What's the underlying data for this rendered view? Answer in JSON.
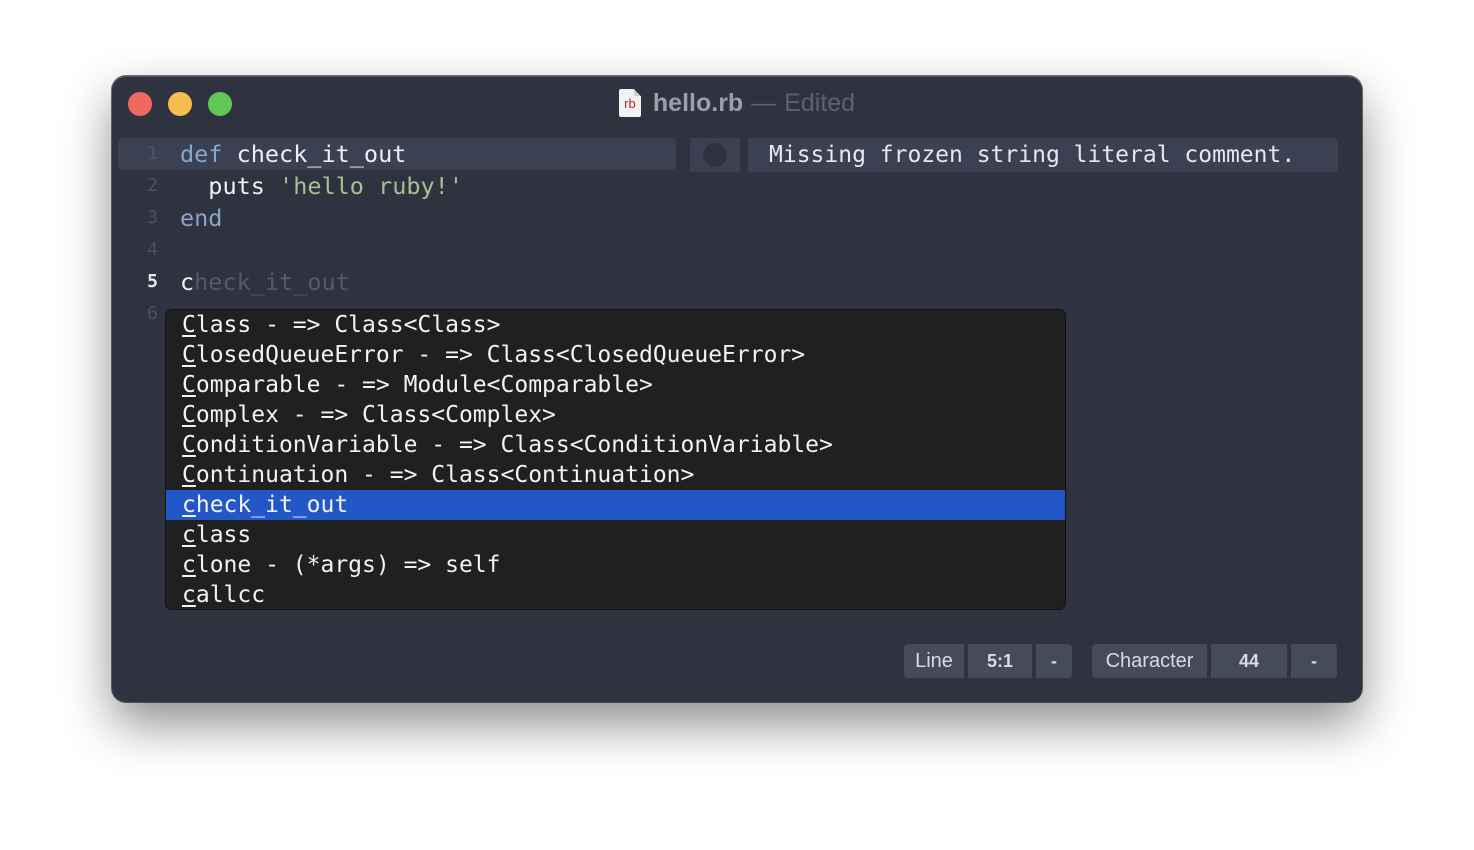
{
  "window": {
    "title": "hello.rb",
    "separator": "—",
    "status": "Edited",
    "file_icon_label": "rb",
    "colors": {
      "close": "#ee6a5f",
      "minimize": "#f5be4f",
      "maximize": "#62c654"
    }
  },
  "editor": {
    "lines": [
      {
        "number": "1",
        "tokens": [
          {
            "text": "def",
            "type": "kw"
          },
          {
            "text": " check_it_out",
            "type": "ident"
          }
        ]
      },
      {
        "number": "2",
        "tokens": [
          {
            "text": "  puts ",
            "type": "ident"
          },
          {
            "text": "'hello ruby!'",
            "type": "str"
          }
        ]
      },
      {
        "number": "3",
        "tokens": [
          {
            "text": "end",
            "type": "kw"
          }
        ]
      },
      {
        "number": "4",
        "tokens": []
      },
      {
        "number": "5",
        "tokens": [
          {
            "text": "c",
            "type": "ident"
          },
          {
            "text": "heck_it_out",
            "type": "ghost"
          }
        ]
      },
      {
        "number": "6",
        "tokens": []
      }
    ],
    "current_line": "5",
    "diagnostic": "Missing frozen string literal comment."
  },
  "completion": {
    "items": [
      {
        "first": "C",
        "rest": "lass - => Class<Class>"
      },
      {
        "first": "C",
        "rest": "losedQueueError - => Class<ClosedQueueError>"
      },
      {
        "first": "C",
        "rest": "omparable - => Module<Comparable>"
      },
      {
        "first": "C",
        "rest": "omplex - => Class<Complex>"
      },
      {
        "first": "C",
        "rest": "onditionVariable - => Class<ConditionVariable>"
      },
      {
        "first": "C",
        "rest": "ontinuation - => Class<Continuation>"
      },
      {
        "first": "c",
        "rest": "heck_it_out"
      },
      {
        "first": "c",
        "rest": "lass"
      },
      {
        "first": "c",
        "rest": "lone - (*args) => self"
      },
      {
        "first": "c",
        "rest": "allcc"
      }
    ],
    "selected_index": 6,
    "selection_color": "#2356c7"
  },
  "statusbar": {
    "line_label": "Line",
    "line_value": "5:1",
    "line_extra": "-",
    "char_label": "Character",
    "char_value": "44",
    "char_extra": "-"
  }
}
